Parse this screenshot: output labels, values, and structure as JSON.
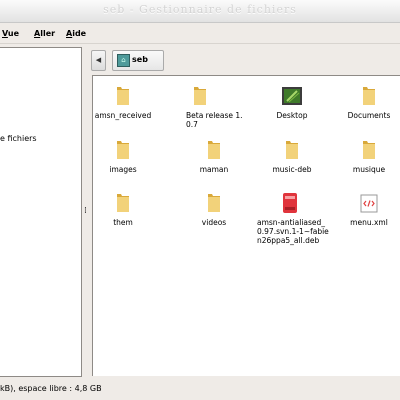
{
  "window": {
    "title": "seb - Gestionnaire de fichiers"
  },
  "menubar": {
    "items": [
      {
        "label": "Vue",
        "ul": "V",
        "rest": "ue"
      },
      {
        "label": "Aller",
        "ul": "A",
        "rest": "ller"
      },
      {
        "label": "Aide",
        "ul": "A",
        "rest": "ide"
      }
    ]
  },
  "sidebar": {
    "partial_label": "e fichiers"
  },
  "location": {
    "folder": "seb"
  },
  "files": [
    {
      "name": "amsn_received",
      "icon": "folder-icon"
    },
    {
      "name": "Beta release 1.0.7",
      "icon": "folder-icon"
    },
    {
      "name": "Desktop",
      "icon": "desktop-icon"
    },
    {
      "name": "Documents",
      "icon": "folder-icon"
    },
    {
      "name": "images",
      "icon": "folder-icon"
    },
    {
      "name": "maman",
      "icon": "folder-icon"
    },
    {
      "name": "music-deb",
      "icon": "folder-icon"
    },
    {
      "name": "musique",
      "icon": "folder-icon"
    },
    {
      "name": "them",
      "icon": "folder-icon"
    },
    {
      "name": "videos",
      "icon": "folder-icon"
    },
    {
      "name": "amsn-antialiased_0.97.svn.1-1~fabien26ppa5_all.deb",
      "icon": "package-icon"
    },
    {
      "name": "menu.xml",
      "icon": "xml-file-icon"
    }
  ],
  "status": {
    "text": "kB), espace libre : 4,8 GB"
  },
  "colors": {
    "folder": "#f2d27a",
    "folder_dark": "#d9a93a",
    "package": "#e0343c"
  }
}
